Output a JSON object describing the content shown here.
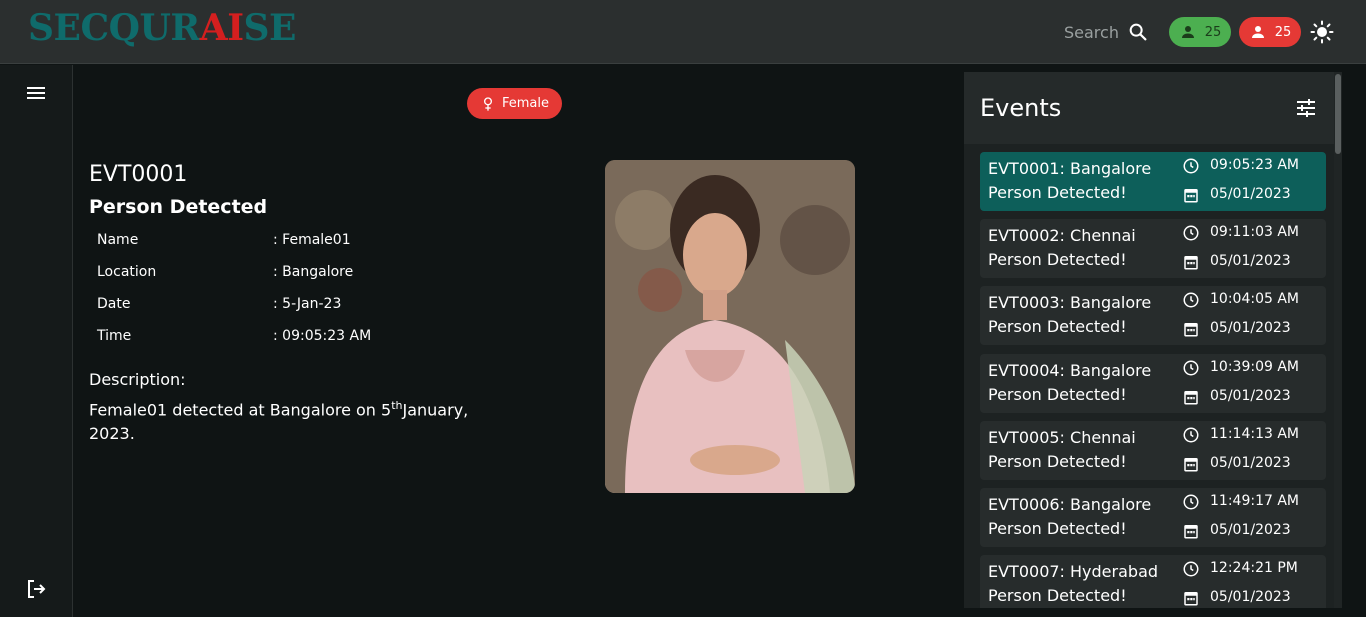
{
  "header": {
    "logo_part1": "SECQUR",
    "logo_ai": "AI",
    "logo_part3": "SE",
    "search_label": "Search",
    "male_count": "25",
    "female_count": "25"
  },
  "main": {
    "gender_badge": "Female",
    "event_id": "EVT0001",
    "event_title": "Person Detected",
    "details": [
      {
        "label": "Name",
        "value": ": Female01"
      },
      {
        "label": "Location",
        "value": ": Bangalore"
      },
      {
        "label": "Date",
        "value": ": 5-Jan-23"
      },
      {
        "label": "Time",
        "value": ": 09:05:23 AM"
      }
    ],
    "description_label": "Description:",
    "description_pre": "Female01 detected at Bangalore on 5",
    "description_sup": "th",
    "description_post": "January, 2023."
  },
  "events": {
    "title": "Events",
    "items": [
      {
        "line1": "EVT0001: Bangalore",
        "line2": "Person Detected!",
        "time": "09:05:23 AM",
        "date": "05/01/2023"
      },
      {
        "line1": "EVT0002: Chennai",
        "line2": "Person Detected!",
        "time": "09:11:03 AM",
        "date": "05/01/2023"
      },
      {
        "line1": "EVT0003: Bangalore",
        "line2": "Person Detected!",
        "time": "10:04:05 AM",
        "date": "05/01/2023"
      },
      {
        "line1": "EVT0004: Bangalore",
        "line2": "Person Detected!",
        "time": "10:39:09 AM",
        "date": "05/01/2023"
      },
      {
        "line1": "EVT0005: Chennai",
        "line2": "Person Detected!",
        "time": "11:14:13 AM",
        "date": "05/01/2023"
      },
      {
        "line1": "EVT0006: Bangalore",
        "line2": "Person Detected!",
        "time": "11:49:17 AM",
        "date": "05/01/2023"
      },
      {
        "line1": "EVT0007: Hyderabad",
        "line2": "Person Detected!",
        "time": "12:24:21 PM",
        "date": "05/01/2023"
      }
    ]
  },
  "colors": {
    "accent_teal": "#0d5f5a",
    "male_green": "#4caf50",
    "female_red": "#e53935"
  },
  "icons": [
    "search-icon",
    "person-icon",
    "sun-icon",
    "menu-icon",
    "logout-icon",
    "female-icon",
    "filter-icon",
    "clock-icon",
    "calendar-icon"
  ]
}
